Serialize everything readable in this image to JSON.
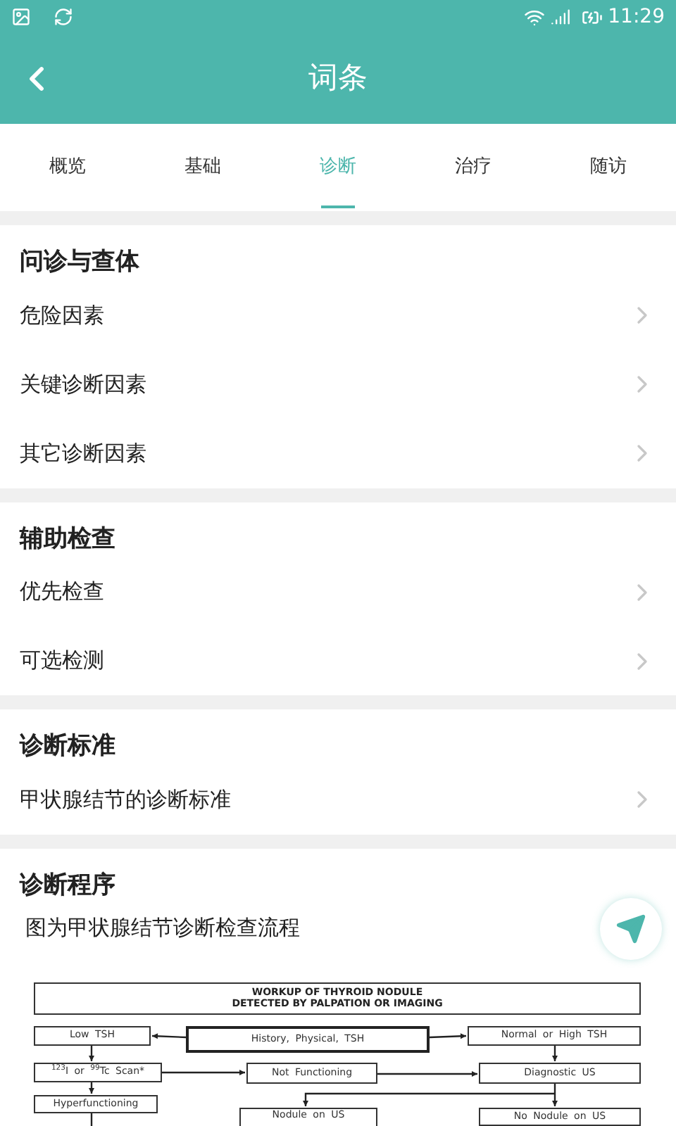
{
  "status_bar": {
    "time": "11:29"
  },
  "header": {
    "title": "词条"
  },
  "tabs": [
    {
      "label": "概览",
      "selected": false
    },
    {
      "label": "基础",
      "selected": false
    },
    {
      "label": "诊断",
      "selected": true
    },
    {
      "label": "治疗",
      "selected": false
    },
    {
      "label": "随访",
      "selected": false
    }
  ],
  "sections": [
    {
      "title": "问诊与查体",
      "items": [
        "危险因素",
        "关键诊断因素",
        "其它诊断因素"
      ]
    },
    {
      "title": "辅助检查",
      "items": [
        "优先检查",
        "可选检测"
      ]
    },
    {
      "title": "诊断标准",
      "items": [
        "甲状腺结节的诊断标准"
      ]
    },
    {
      "title": "诊断程序",
      "caption": "图为甲状腺结节诊断检查流程",
      "flowchart": {
        "heading": [
          "WORKUP OF THYROID NODULE",
          "DETECTED BY PALPATION OR IMAGING"
        ],
        "nodes": [
          "Low TSH",
          "History, Physical, TSH",
          "Normal or High TSH",
          "$^{123}$I or $^{99}$Tc Scan*",
          "Not Functioning",
          "Diagnostic US",
          "Hyperfunctioning",
          "Nodule on US",
          "No Nodule on US"
        ]
      }
    }
  ]
}
